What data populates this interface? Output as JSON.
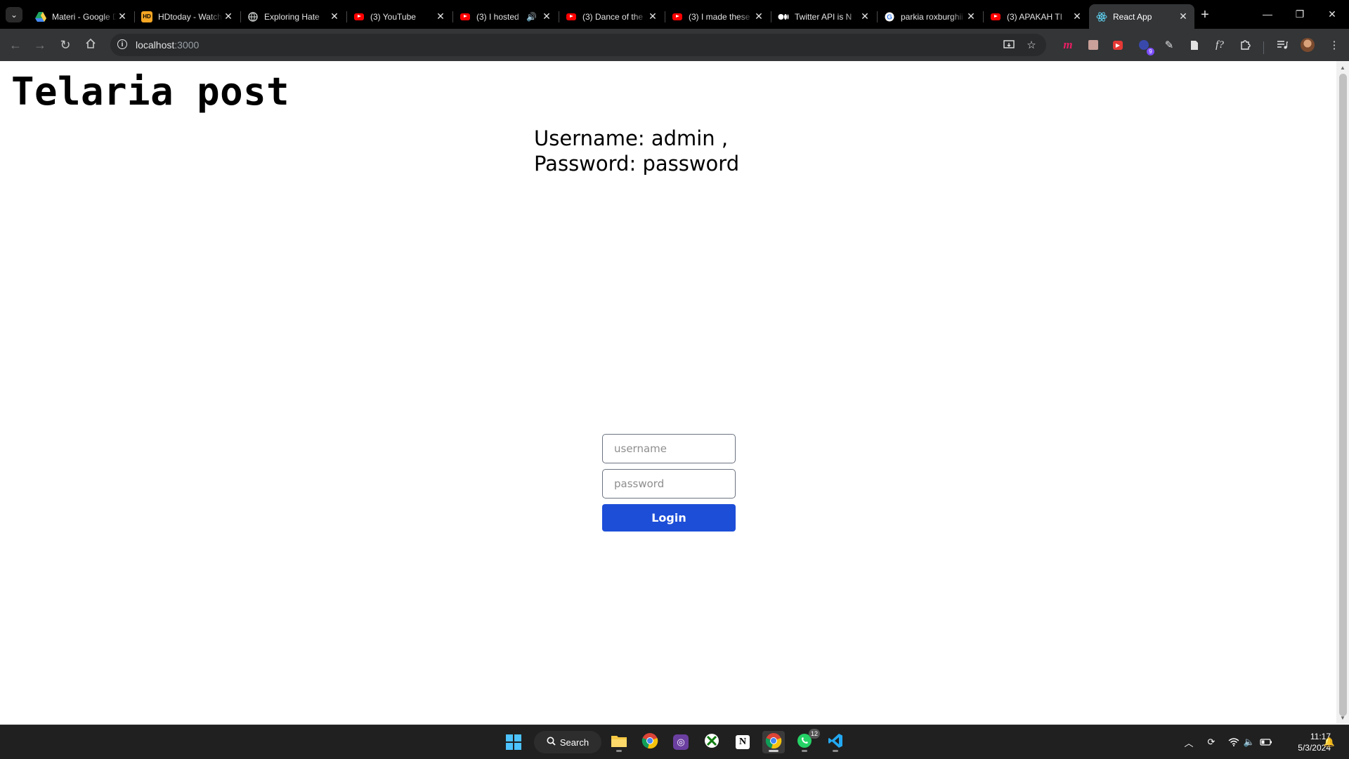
{
  "browser": {
    "tabs": [
      {
        "title": "Materi - Google Drive",
        "icon": "google-drive-icon",
        "active": false
      },
      {
        "title": "HDtoday - Watch",
        "icon": "hdtoday-icon",
        "active": false
      },
      {
        "title": "Exploring Hate",
        "icon": "globe-icon",
        "active": false
      },
      {
        "title": "(3) YouTube",
        "icon": "youtube-icon",
        "active": false
      },
      {
        "title": "(3) I hosted",
        "icon": "youtube-icon",
        "active": false,
        "audio": true
      },
      {
        "title": "(3) Dance of the",
        "icon": "youtube-icon",
        "active": false
      },
      {
        "title": "(3) I made these",
        "icon": "youtube-icon",
        "active": false
      },
      {
        "title": "Twitter API is N",
        "icon": "medium-icon",
        "active": false
      },
      {
        "title": "parkia roxburghii",
        "icon": "google-icon",
        "active": false
      },
      {
        "title": "(3) APAKAH TI",
        "icon": "youtube-icon",
        "active": false
      },
      {
        "title": "React App",
        "icon": "react-icon",
        "active": true
      }
    ],
    "url_host": "localhost",
    "url_port": ":3000"
  },
  "page": {
    "heading": "Telaria post",
    "credentials_hint": "Username: admin , Password: password",
    "form": {
      "username_placeholder": "username",
      "password_placeholder": "password",
      "login_label": "Login"
    }
  },
  "taskbar": {
    "search_label": "Search",
    "whatsapp_badge": "12",
    "extension_badge": "9",
    "time": "11:17",
    "date": "5/3/2024"
  },
  "colors": {
    "login_button": "#1d4ed8",
    "chrome_dark": "#333537",
    "taskbar": "#202020"
  }
}
